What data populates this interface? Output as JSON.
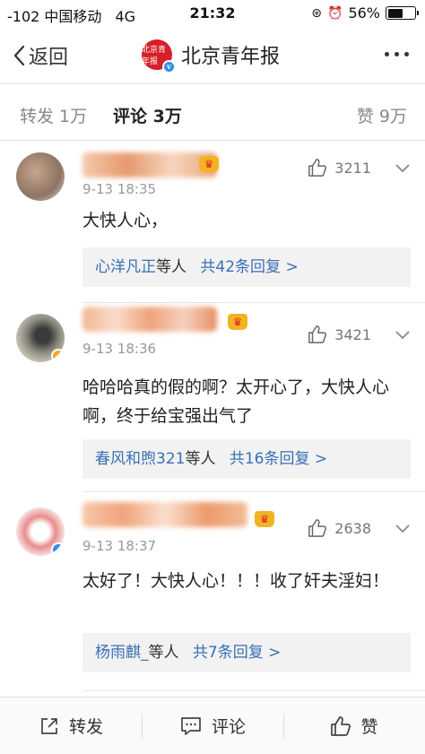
{
  "status_bar": {
    "carrier": "-102 中国移动",
    "network": "4G",
    "time": "21:32",
    "battery": "56%",
    "battery_level": 0.56
  },
  "nav": {
    "back_label": "返回",
    "title": "北京青年报",
    "logo_text": "北京青年报",
    "verified_mark": "v"
  },
  "tabs": {
    "repost": "转发 1万",
    "comments": "评论 3万",
    "likes": "赞 9万"
  },
  "comments": [
    {
      "time": "9-13 18:35",
      "likes": "3211",
      "text": "大快人心，",
      "reply_users": "心洋凡正",
      "reply_suffix": "等人",
      "reply_count": "共42条回复 >"
    },
    {
      "time": "9-13 18:36",
      "likes": "3421",
      "text": "哈哈哈真的假的啊？太开心了，大快人心啊，终于给宝强出气了",
      "reply_users": "春风和煦321",
      "reply_suffix": "等人",
      "reply_count": "共16条回复 >"
    },
    {
      "time": "9-13 18:37",
      "likes": "2638",
      "text": "太好了！大快人心！！！收了奸夫淫妇！",
      "reply_users": "杨雨麒_",
      "reply_suffix": "等人",
      "reply_count": "共7条回复 >"
    }
  ],
  "bottom_bar": {
    "repost": "转发",
    "comment": "评论",
    "like": "赞"
  },
  "colors": {
    "link": "#3a6fb5",
    "brand_red": "#d61f28",
    "crown": "#f3b221"
  }
}
